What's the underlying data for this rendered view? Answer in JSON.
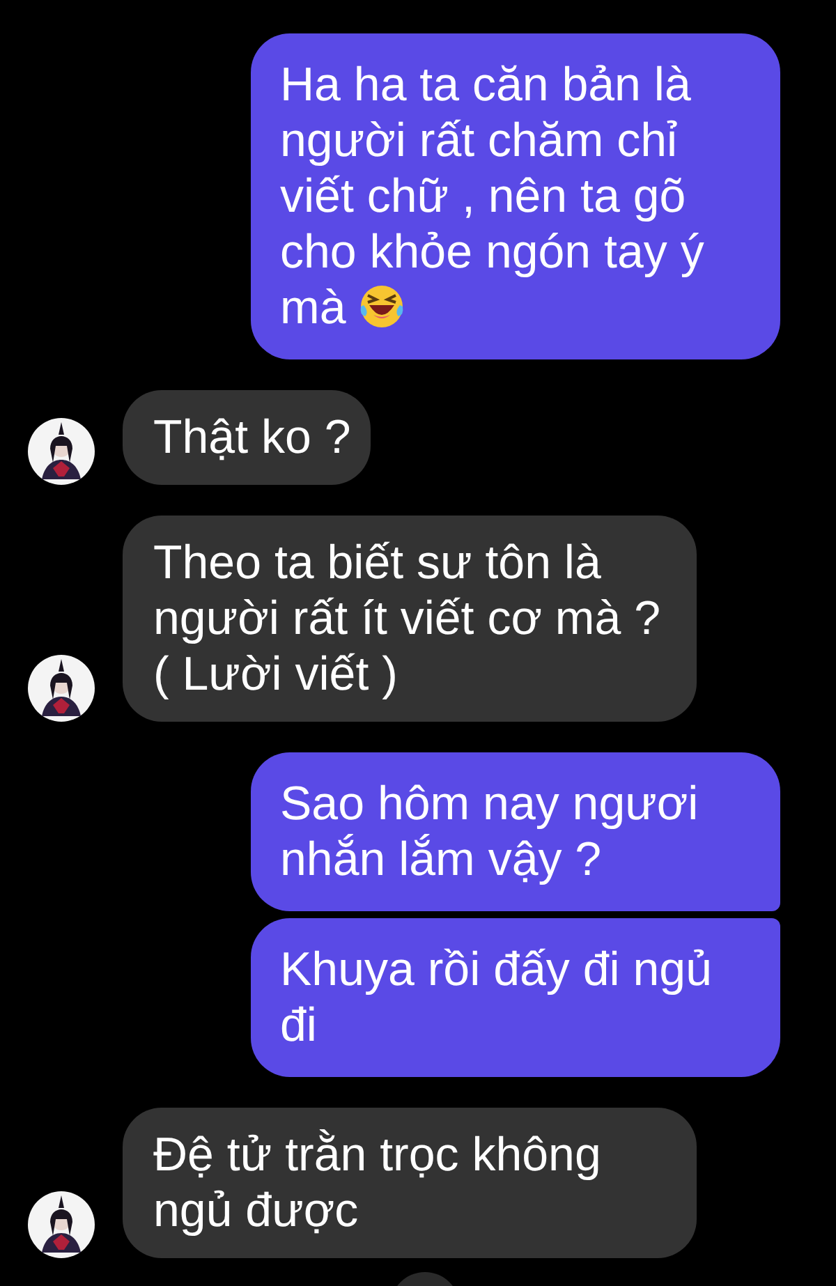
{
  "messages": [
    {
      "kind": "sent",
      "text": "Ha ha ta căn bản là người rất chăm chỉ viết chữ , nên ta gõ cho khỏe ngón tay ý mà",
      "emoji": true
    },
    {
      "kind": "received",
      "text": "Thật ko ?"
    },
    {
      "kind": "received",
      "text": "Theo ta biết sư tôn là người rất ít viết cơ mà ? ( Lười viết )"
    },
    {
      "kind": "sent",
      "text": "Sao hôm nay ngươi nhắn lắm vậy ?"
    },
    {
      "kind": "sent",
      "text": "Khuya rồi đấy đi ngủ đi"
    },
    {
      "kind": "received",
      "text": "Đệ tử trằn trọc không ngủ được"
    }
  ]
}
